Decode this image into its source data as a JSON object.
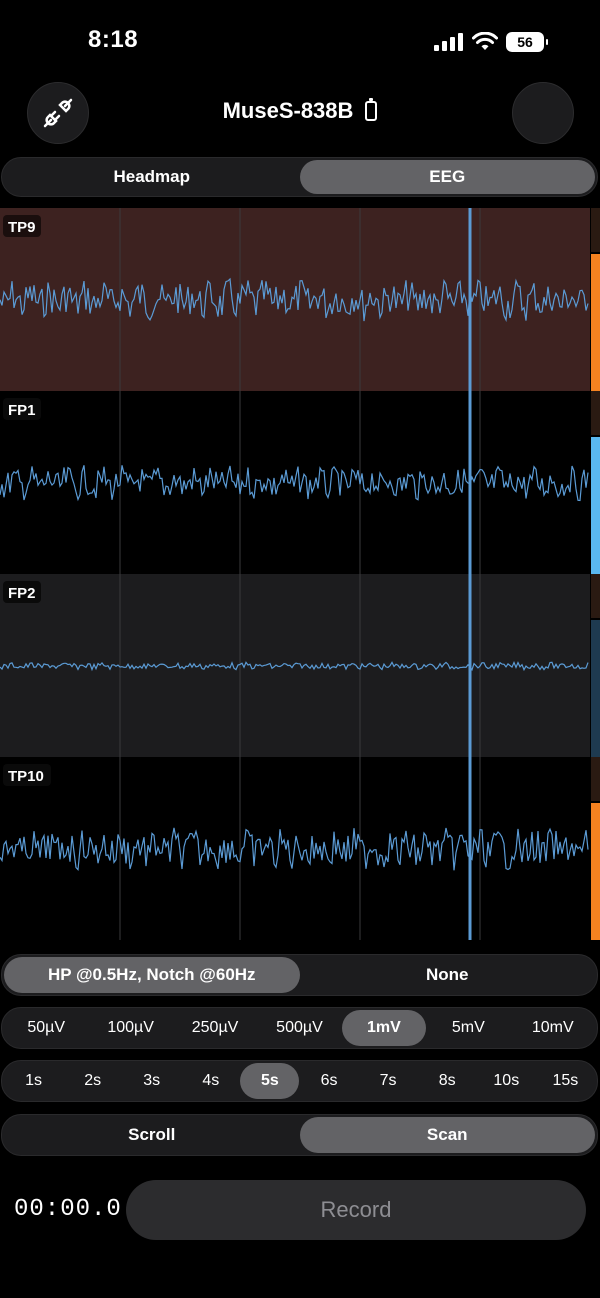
{
  "status_bar": {
    "time": "8:18",
    "battery_level": "56",
    "icons": [
      "cellular-signal-icon",
      "wifi-icon",
      "battery-icon"
    ]
  },
  "header": {
    "device_name": "MuseS-838B",
    "left_icon": "plug-disconnect-icon",
    "battery_icon": "battery-icon"
  },
  "view_tabs": {
    "options": [
      "Headmap",
      "EEG"
    ],
    "selected": "EEG"
  },
  "eeg": {
    "channels": [
      {
        "label": "TP9",
        "amplitude": "high",
        "background": "#3d2220",
        "indicator": "#f58220"
      },
      {
        "label": "FP1",
        "amplitude": "medium",
        "background": "#000000",
        "indicator": "#5ab8f0"
      },
      {
        "label": "FP2",
        "amplitude": "low",
        "background": "#1c1c1e",
        "indicator": "#1e3a50"
      },
      {
        "label": "TP10",
        "amplitude": "high",
        "background": "#000000",
        "indicator": "#f58220"
      }
    ],
    "trace_color": "#5b9bd5",
    "cursor_color": "#5b9bd5"
  },
  "filter": {
    "options": [
      "HP @0.5Hz, Notch @60Hz",
      "None"
    ],
    "selected": "HP @0.5Hz, Notch @60Hz"
  },
  "scale": {
    "options": [
      "50µV",
      "100µV",
      "250µV",
      "500µV",
      "1mV",
      "5mV",
      "10mV"
    ],
    "selected": "1mV"
  },
  "timespan": {
    "options": [
      "1s",
      "2s",
      "3s",
      "4s",
      "5s",
      "6s",
      "7s",
      "8s",
      "10s",
      "15s"
    ],
    "selected": "5s"
  },
  "mode": {
    "options": [
      "Scroll",
      "Scan"
    ],
    "selected": "Scan"
  },
  "recording": {
    "elapsed": "00:00.0",
    "button_label": "Record"
  }
}
